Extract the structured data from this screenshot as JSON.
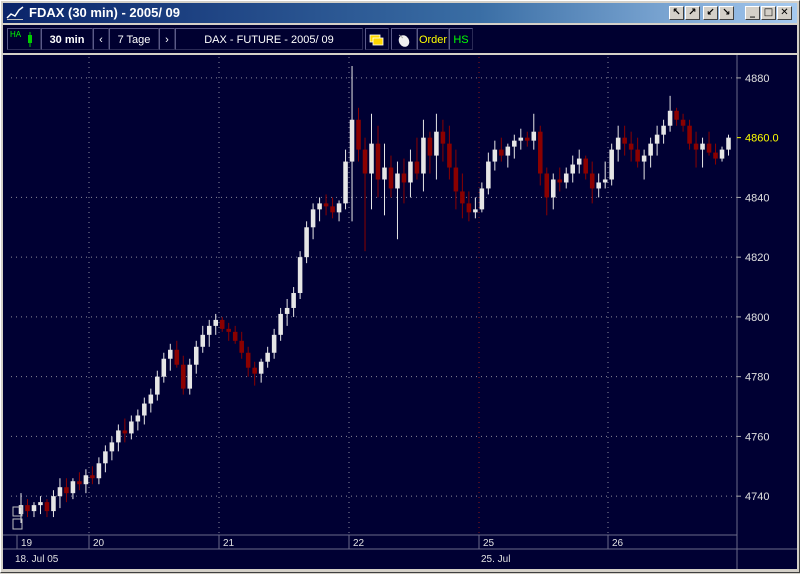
{
  "window": {
    "title": "FDAX  (30 min) - 2005/ 09",
    "buttons": [
      "↖",
      "↗",
      "↙",
      "↘"
    ],
    "controls": [
      "_",
      "□",
      "✕"
    ]
  },
  "toolbar": {
    "ha_label": "HA",
    "interval": "30 min",
    "nav_prev": "‹",
    "range": "7 Tage",
    "nav_next": "›",
    "instrument": "DAX - FUTURE - 2005/ 09",
    "order": "Order",
    "hs": "HS"
  },
  "chart_data": {
    "type": "candlestick",
    "instrument": "DAX - FUTURE - 2005/ 09",
    "ylim": [
      4727,
      4887
    ],
    "yticks": [
      4740,
      4760,
      4780,
      4800,
      4820,
      4840,
      4880
    ],
    "last_price": "4860.0",
    "day_labels": [
      "19",
      "20",
      "21",
      "22",
      "25",
      "26"
    ],
    "bottom_labels": [
      "18. Jul 05",
      "25. Jul"
    ],
    "colors": {
      "background": "#000033",
      "grid": "#8a8a98",
      "up": "#e6e6e6",
      "down": "#8b0000",
      "last_price": "#ffff00",
      "weekly_line": "#8b1a1a"
    },
    "candles": [
      {
        "o": 4734,
        "h": 4741,
        "l": 4731,
        "c": 4737
      },
      {
        "o": 4737,
        "h": 4739,
        "l": 4733,
        "c": 4735
      },
      {
        "o": 4735,
        "h": 4738,
        "l": 4733,
        "c": 4737
      },
      {
        "o": 4737,
        "h": 4740,
        "l": 4734,
        "c": 4738
      },
      {
        "o": 4738,
        "h": 4739,
        "l": 4733,
        "c": 4735
      },
      {
        "o": 4735,
        "h": 4742,
        "l": 4733,
        "c": 4740
      },
      {
        "o": 4740,
        "h": 4746,
        "l": 4736,
        "c": 4743
      },
      {
        "o": 4743,
        "h": 4746,
        "l": 4738,
        "c": 4741
      },
      {
        "o": 4741,
        "h": 4746,
        "l": 4739,
        "c": 4745
      },
      {
        "o": 4745,
        "h": 4748,
        "l": 4742,
        "c": 4744
      },
      {
        "o": 4744,
        "h": 4749,
        "l": 4741,
        "c": 4747
      },
      {
        "o": 4747,
        "h": 4750,
        "l": 4744,
        "c": 4746
      },
      {
        "o": 4746,
        "h": 4753,
        "l": 4744,
        "c": 4751
      },
      {
        "o": 4751,
        "h": 4757,
        "l": 4748,
        "c": 4755
      },
      {
        "o": 4755,
        "h": 4760,
        "l": 4752,
        "c": 4758
      },
      {
        "o": 4758,
        "h": 4764,
        "l": 4755,
        "c": 4762
      },
      {
        "o": 4762,
        "h": 4766,
        "l": 4758,
        "c": 4761
      },
      {
        "o": 4761,
        "h": 4767,
        "l": 4759,
        "c": 4765
      },
      {
        "o": 4765,
        "h": 4769,
        "l": 4762,
        "c": 4767
      },
      {
        "o": 4767,
        "h": 4773,
        "l": 4764,
        "c": 4771
      },
      {
        "o": 4771,
        "h": 4776,
        "l": 4768,
        "c": 4774
      },
      {
        "o": 4774,
        "h": 4782,
        "l": 4772,
        "c": 4780
      },
      {
        "o": 4780,
        "h": 4788,
        "l": 4778,
        "c": 4786
      },
      {
        "o": 4786,
        "h": 4791,
        "l": 4782,
        "c": 4789
      },
      {
        "o": 4789,
        "h": 4792,
        "l": 4783,
        "c": 4784
      },
      {
        "o": 4784,
        "h": 4787,
        "l": 4774,
        "c": 4776
      },
      {
        "o": 4776,
        "h": 4786,
        "l": 4774,
        "c": 4784
      },
      {
        "o": 4784,
        "h": 4792,
        "l": 4781,
        "c": 4790
      },
      {
        "o": 4790,
        "h": 4797,
        "l": 4788,
        "c": 4794
      },
      {
        "o": 4794,
        "h": 4799,
        "l": 4790,
        "c": 4797
      },
      {
        "o": 4797,
        "h": 4801,
        "l": 4794,
        "c": 4799
      },
      {
        "o": 4799,
        "h": 4800,
        "l": 4795,
        "c": 4796
      },
      {
        "o": 4796,
        "h": 4798,
        "l": 4792,
        "c": 4795
      },
      {
        "o": 4795,
        "h": 4797,
        "l": 4791,
        "c": 4792
      },
      {
        "o": 4792,
        "h": 4795,
        "l": 4786,
        "c": 4788
      },
      {
        "o": 4788,
        "h": 4790,
        "l": 4780,
        "c": 4783
      },
      {
        "o": 4783,
        "h": 4785,
        "l": 4777,
        "c": 4781
      },
      {
        "o": 4781,
        "h": 4786,
        "l": 4778,
        "c": 4785
      },
      {
        "o": 4785,
        "h": 4790,
        "l": 4783,
        "c": 4788
      },
      {
        "o": 4788,
        "h": 4796,
        "l": 4786,
        "c": 4794
      },
      {
        "o": 4794,
        "h": 4803,
        "l": 4792,
        "c": 4801
      },
      {
        "o": 4801,
        "h": 4806,
        "l": 4797,
        "c": 4803
      },
      {
        "o": 4803,
        "h": 4810,
        "l": 4800,
        "c": 4808
      },
      {
        "o": 4808,
        "h": 4822,
        "l": 4806,
        "c": 4820
      },
      {
        "o": 4820,
        "h": 4832,
        "l": 4818,
        "c": 4830
      },
      {
        "o": 4830,
        "h": 4838,
        "l": 4826,
        "c": 4836
      },
      {
        "o": 4836,
        "h": 4840,
        "l": 4832,
        "c": 4838
      },
      {
        "o": 4838,
        "h": 4841,
        "l": 4834,
        "c": 4837
      },
      {
        "o": 4837,
        "h": 4840,
        "l": 4833,
        "c": 4835
      },
      {
        "o": 4835,
        "h": 4839,
        "l": 4832,
        "c": 4838
      },
      {
        "o": 4838,
        "h": 4856,
        "l": 4836,
        "c": 4852
      },
      {
        "o": 4852,
        "h": 4884,
        "l": 4832,
        "c": 4866
      },
      {
        "o": 4866,
        "h": 4870,
        "l": 4852,
        "c": 4856
      },
      {
        "o": 4856,
        "h": 4860,
        "l": 4822,
        "c": 4848
      },
      {
        "o": 4848,
        "h": 4868,
        "l": 4836,
        "c": 4858
      },
      {
        "o": 4858,
        "h": 4864,
        "l": 4840,
        "c": 4846
      },
      {
        "o": 4846,
        "h": 4858,
        "l": 4834,
        "c": 4850
      },
      {
        "o": 4850,
        "h": 4854,
        "l": 4840,
        "c": 4843
      },
      {
        "o": 4843,
        "h": 4852,
        "l": 4826,
        "c": 4848
      },
      {
        "o": 4848,
        "h": 4853,
        "l": 4838,
        "c": 4845
      },
      {
        "o": 4845,
        "h": 4856,
        "l": 4840,
        "c": 4852
      },
      {
        "o": 4852,
        "h": 4860,
        "l": 4846,
        "c": 4848
      },
      {
        "o": 4848,
        "h": 4866,
        "l": 4842,
        "c": 4860
      },
      {
        "o": 4860,
        "h": 4862,
        "l": 4848,
        "c": 4854
      },
      {
        "o": 4854,
        "h": 4868,
        "l": 4846,
        "c": 4862
      },
      {
        "o": 4862,
        "h": 4866,
        "l": 4852,
        "c": 4858
      },
      {
        "o": 4858,
        "h": 4864,
        "l": 4846,
        "c": 4850
      },
      {
        "o": 4850,
        "h": 4856,
        "l": 4836,
        "c": 4842
      },
      {
        "o": 4842,
        "h": 4848,
        "l": 4833,
        "c": 4838
      },
      {
        "o": 4838,
        "h": 4842,
        "l": 4832,
        "c": 4835
      },
      {
        "o": 4835,
        "h": 4840,
        "l": 4833,
        "c": 4836
      },
      {
        "o": 4836,
        "h": 4845,
        "l": 4835,
        "c": 4843
      },
      {
        "o": 4843,
        "h": 4855,
        "l": 4841,
        "c": 4852
      },
      {
        "o": 4852,
        "h": 4859,
        "l": 4849,
        "c": 4856
      },
      {
        "o": 4856,
        "h": 4860,
        "l": 4852,
        "c": 4854
      },
      {
        "o": 4854,
        "h": 4858,
        "l": 4850,
        "c": 4857
      },
      {
        "o": 4857,
        "h": 4861,
        "l": 4853,
        "c": 4859
      },
      {
        "o": 4859,
        "h": 4863,
        "l": 4856,
        "c": 4860
      },
      {
        "o": 4860,
        "h": 4862,
        "l": 4857,
        "c": 4859
      },
      {
        "o": 4859,
        "h": 4868,
        "l": 4856,
        "c": 4862
      },
      {
        "o": 4862,
        "h": 4864,
        "l": 4844,
        "c": 4848
      },
      {
        "o": 4848,
        "h": 4850,
        "l": 4834,
        "c": 4840
      },
      {
        "o": 4840,
        "h": 4848,
        "l": 4836,
        "c": 4846
      },
      {
        "o": 4846,
        "h": 4850,
        "l": 4842,
        "c": 4845
      },
      {
        "o": 4845,
        "h": 4850,
        "l": 4843,
        "c": 4848
      },
      {
        "o": 4848,
        "h": 4854,
        "l": 4845,
        "c": 4851
      },
      {
        "o": 4851,
        "h": 4856,
        "l": 4848,
        "c": 4853
      },
      {
        "o": 4853,
        "h": 4854,
        "l": 4846,
        "c": 4848
      },
      {
        "o": 4848,
        "h": 4852,
        "l": 4838,
        "c": 4843
      },
      {
        "o": 4843,
        "h": 4848,
        "l": 4840,
        "c": 4845
      },
      {
        "o": 4845,
        "h": 4852,
        "l": 4843,
        "c": 4846
      },
      {
        "o": 4846,
        "h": 4858,
        "l": 4844,
        "c": 4856
      },
      {
        "o": 4856,
        "h": 4864,
        "l": 4852,
        "c": 4860
      },
      {
        "o": 4860,
        "h": 4864,
        "l": 4854,
        "c": 4858
      },
      {
        "o": 4858,
        "h": 4862,
        "l": 4852,
        "c": 4856
      },
      {
        "o": 4856,
        "h": 4860,
        "l": 4850,
        "c": 4852
      },
      {
        "o": 4852,
        "h": 4856,
        "l": 4846,
        "c": 4854
      },
      {
        "o": 4854,
        "h": 4860,
        "l": 4850,
        "c": 4858
      },
      {
        "o": 4858,
        "h": 4864,
        "l": 4854,
        "c": 4861
      },
      {
        "o": 4861,
        "h": 4866,
        "l": 4858,
        "c": 4864
      },
      {
        "o": 4864,
        "h": 4874,
        "l": 4862,
        "c": 4869
      },
      {
        "o": 4869,
        "h": 4870,
        "l": 4864,
        "c": 4866
      },
      {
        "o": 4866,
        "h": 4868,
        "l": 4862,
        "c": 4864
      },
      {
        "o": 4864,
        "h": 4866,
        "l": 4856,
        "c": 4858
      },
      {
        "o": 4858,
        "h": 4862,
        "l": 4850,
        "c": 4856
      },
      {
        "o": 4856,
        "h": 4860,
        "l": 4850,
        "c": 4858
      },
      {
        "o": 4858,
        "h": 4862,
        "l": 4854,
        "c": 4855
      },
      {
        "o": 4855,
        "h": 4858,
        "l": 4851,
        "c": 4853
      },
      {
        "o": 4853,
        "h": 4857,
        "l": 4852,
        "c": 4856
      },
      {
        "o": 4856,
        "h": 4861,
        "l": 4854,
        "c": 4860
      }
    ]
  }
}
